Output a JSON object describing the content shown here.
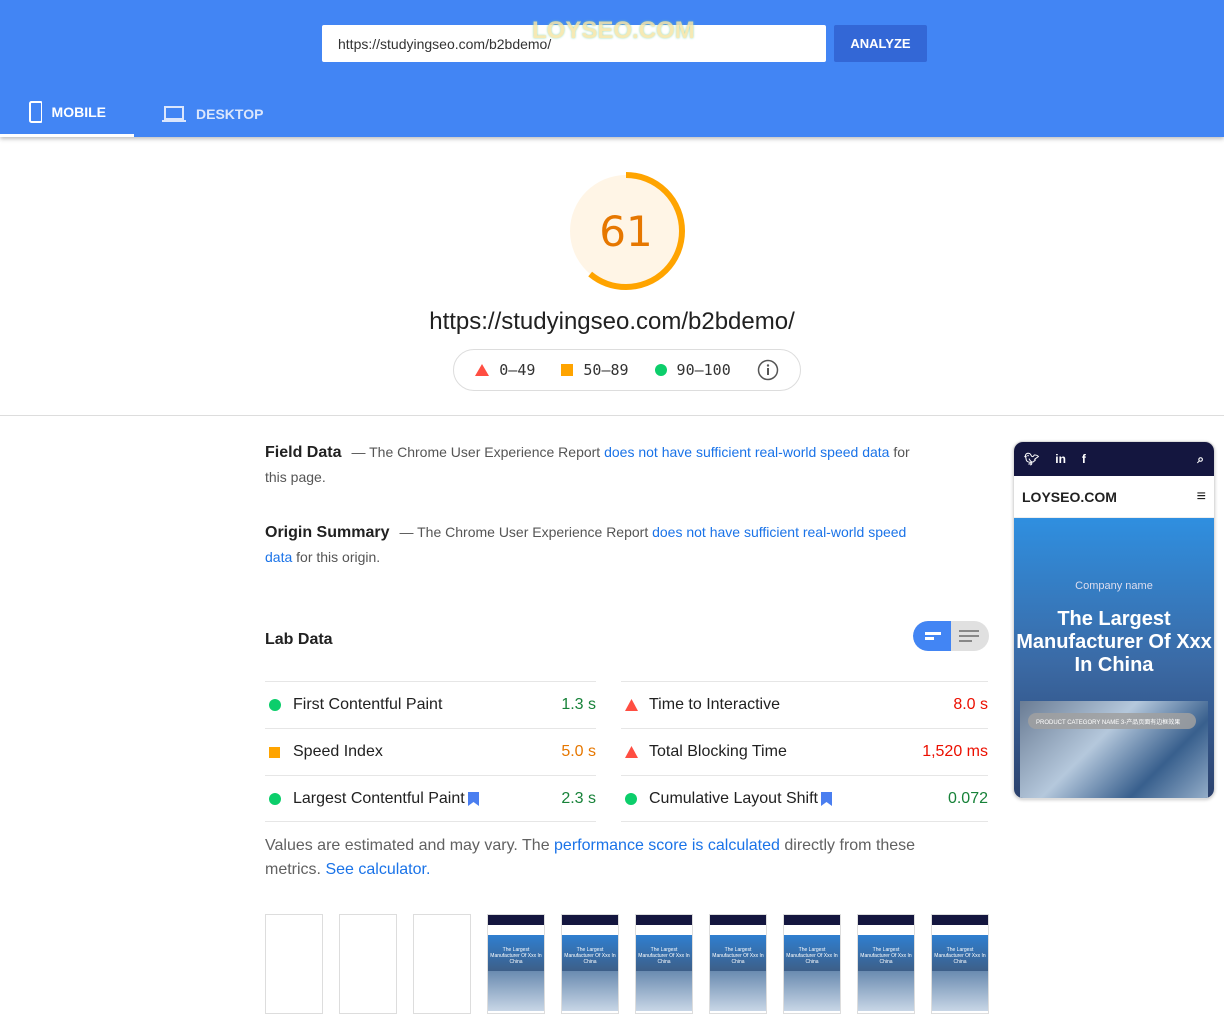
{
  "header": {
    "url_value": "https://studyingseo.com/b2bdemo/",
    "analyze_label": "ANALYZE",
    "watermark": "LOYSEO.COM",
    "tabs": [
      {
        "label": "MOBILE",
        "icon": "phone-icon",
        "active": true
      },
      {
        "label": "DESKTOP",
        "icon": "laptop-icon",
        "active": false
      }
    ]
  },
  "score": {
    "value": "61",
    "percent": 61,
    "color": "#ffa400"
  },
  "page_url": "https://studyingseo.com/b2bdemo/",
  "legend": [
    {
      "range": "0–49",
      "icon": "red-triangle-icon",
      "color": "#ff4e42"
    },
    {
      "range": "50–89",
      "icon": "orange-square-icon",
      "color": "#ffa400"
    },
    {
      "range": "90–100",
      "icon": "green-circle-icon",
      "color": "#0cce6b"
    }
  ],
  "field": {
    "title": "Field Data",
    "pre": "— The Chrome User Experience Report ",
    "link": "does not have sufficient real-world speed data",
    "post": " for this page."
  },
  "origin": {
    "title": "Origin Summary",
    "pre": "— The Chrome User Experience Report ",
    "link": "does not have sufficient real-world speed data",
    "post": " for this origin."
  },
  "lab": {
    "title": "Lab Data",
    "left": [
      {
        "name": "First Contentful Paint",
        "value": "1.3 s",
        "status": "good"
      },
      {
        "name": "Speed Index",
        "value": "5.0 s",
        "status": "average"
      },
      {
        "name": "Largest Contentful Paint",
        "value": "2.3 s",
        "status": "good",
        "flag": true
      }
    ],
    "right": [
      {
        "name": "Time to Interactive",
        "value": "8.0 s",
        "status": "poor"
      },
      {
        "name": "Total Blocking Time",
        "value": "1,520 ms",
        "status": "poor"
      },
      {
        "name": "Cumulative Layout Shift",
        "value": "0.072",
        "status": "good",
        "flag": true
      }
    ]
  },
  "note": {
    "pre": "Values are estimated and may vary. The ",
    "link1": "performance score is calculated",
    "mid": " directly from these metrics. ",
    "link2": "See calculator."
  },
  "preview": {
    "logo": "LOYSEO.COM",
    "company": "Company name",
    "headline": "The Largest Manufacturer Of Xxx In China",
    "pill": "PRODUCT CATEGORY NAME 3-产品页面有边框效果"
  },
  "filmstrip": {
    "frames": [
      false,
      false,
      false,
      true,
      true,
      true,
      true,
      true,
      true,
      true
    ],
    "caption": "The Largest Manufacturer Of Xxx In China"
  },
  "colors": {
    "header": "#4285f4",
    "good": "#0cce6b",
    "good_text": "#178239",
    "average": "#ffa400",
    "average_text": "#e67700",
    "poor": "#ff4e42",
    "poor_text": "#eb0f00"
  }
}
